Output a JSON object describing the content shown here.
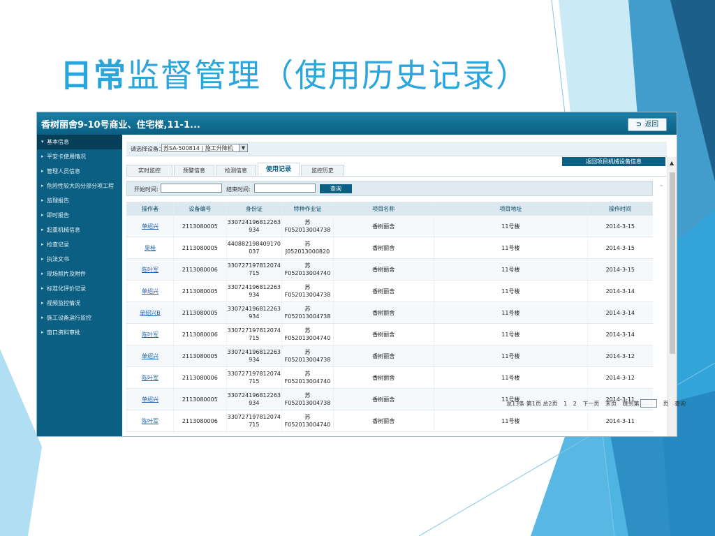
{
  "slide": {
    "title_strong": "日常",
    "title_rest": "监督管理（使用历史记录）"
  },
  "window": {
    "title": "香树丽舍9-10号商业、住宅楼,11-1...",
    "back_label": "返回"
  },
  "sidebar": {
    "items": [
      {
        "label": "基本信息"
      },
      {
        "label": "平安卡使用情况"
      },
      {
        "label": "管理人员信息"
      },
      {
        "label": "危险性较大的分部分项工程"
      },
      {
        "label": "监理报告"
      },
      {
        "label": "即时报告"
      },
      {
        "label": "起重机械信息"
      },
      {
        "label": "检查记录"
      },
      {
        "label": "执法文书"
      },
      {
        "label": "现场照片及附件"
      },
      {
        "label": "标准化评价记录"
      },
      {
        "label": "视频监控情况"
      },
      {
        "label": "施工设备运行监控"
      },
      {
        "label": "窗口资料审批"
      }
    ]
  },
  "device": {
    "label": "请选择设备：",
    "selected": "苏SA-500814 | 施工升降机"
  },
  "return_device_label": "返回项目机械设备信息",
  "tabs": [
    {
      "label": "实时监控"
    },
    {
      "label": "预警信息"
    },
    {
      "label": "检测信息"
    },
    {
      "label": "使用记录"
    },
    {
      "label": "监控历史"
    }
  ],
  "filter": {
    "start_label": "开始时间:",
    "end_label": "结束时间:",
    "query_label": "查询"
  },
  "table": {
    "headers": [
      "操作者",
      "设备编号",
      "身份证",
      "特种作业证",
      "项目名称",
      "项目地址",
      "操作时间"
    ],
    "rows": [
      [
        "单绍兴",
        "2113080005",
        "330724196812263 934",
        "苏F052013004738",
        "香树丽舍",
        "11号楼",
        "2014-3-15"
      ],
      [
        "吴桂",
        "2113080005",
        "440882198409170 037",
        "苏J052013000820",
        "香树丽舍",
        "11号楼",
        "2014-3-15"
      ],
      [
        "陈叶军",
        "2113080006",
        "330727197812074 715",
        "苏F052013004740",
        "香树丽舍",
        "11号楼",
        "2014-3-15"
      ],
      [
        "单绍兴",
        "2113080005",
        "330724196812263 934",
        "苏F052013004738",
        "香树丽舍",
        "11号楼",
        "2014-3-14"
      ],
      [
        "单绍兴B",
        "2113080005",
        "330724196812263 934",
        "苏F052013004738",
        "香树丽舍",
        "11号楼",
        "2014-3-14"
      ],
      [
        "陈叶军",
        "2113080006",
        "330727197812074 715",
        "苏F052013004740",
        "香树丽舍",
        "11号楼",
        "2014-3-14"
      ],
      [
        "单绍兴",
        "2113080005",
        "330724196812263 934",
        "苏F052013004738",
        "香树丽舍",
        "11号楼",
        "2014-3-12"
      ],
      [
        "陈叶军",
        "2113080006",
        "330727197812074 715",
        "苏F052013004740",
        "香树丽舍",
        "11号楼",
        "2014-3-12"
      ],
      [
        "单绍兴",
        "2113080005",
        "330724196812263 934",
        "苏F052013004738",
        "香树丽舍",
        "11号楼",
        "2014-3-11"
      ],
      [
        "陈叶军",
        "2113080006",
        "330727197812074 715",
        "苏F052013004740",
        "香树丽舍",
        "11号楼",
        "2014-3-11"
      ]
    ]
  },
  "pager": {
    "summary": "总13条 第1页 总2页",
    "page1": "1",
    "page2": "2",
    "next": "下一页",
    "last": "末页",
    "jump_label": "跳到第",
    "jump_suffix": "页",
    "go": "查询"
  },
  "colors": {
    "accent": "#2aa6dc",
    "header": "#0b5f83"
  }
}
